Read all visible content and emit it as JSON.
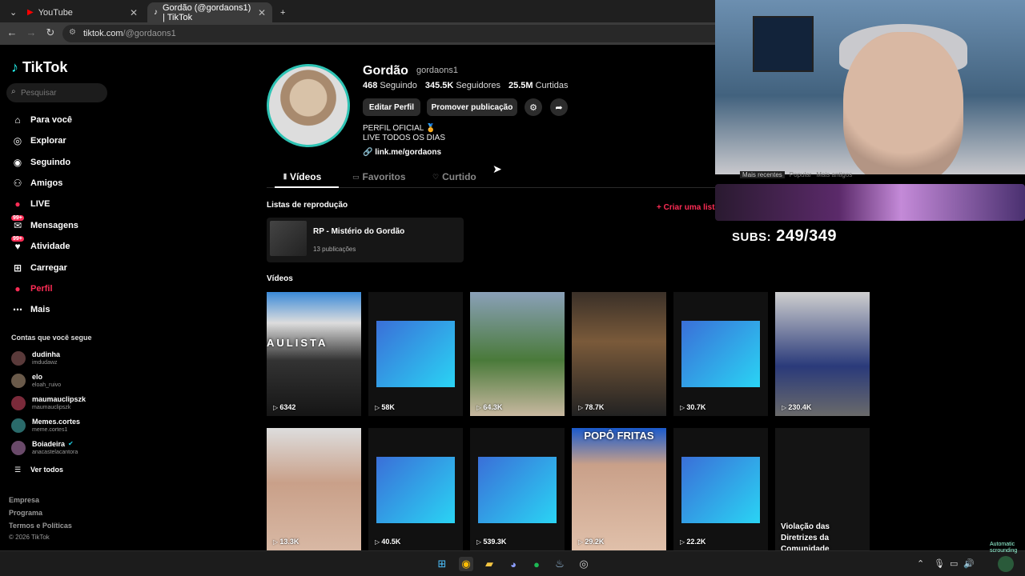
{
  "browser": {
    "tabs": [
      {
        "title": "YouTube",
        "active": false
      },
      {
        "title": "Gordão (@gordaons1) | TikTok",
        "active": true
      }
    ],
    "url_domain": "tiktok.com",
    "url_path": "/@gordaons1"
  },
  "sidebar": {
    "logo": "TikTok",
    "search_placeholder": "Pesquisar",
    "nav": [
      {
        "label": "Para você",
        "icon": "home-icon"
      },
      {
        "label": "Explorar",
        "icon": "compass-icon"
      },
      {
        "label": "Seguindo",
        "icon": "following-icon"
      },
      {
        "label": "Amigos",
        "icon": "friends-icon"
      },
      {
        "label": "LIVE",
        "icon": "live-icon"
      },
      {
        "label": "Mensagens",
        "icon": "messages-icon",
        "badge": "99+"
      },
      {
        "label": "Atividade",
        "icon": "activity-icon",
        "badge": "99+"
      },
      {
        "label": "Carregar",
        "icon": "upload-icon"
      },
      {
        "label": "Perfil",
        "icon": "profile-icon",
        "selected": true
      },
      {
        "label": "Mais",
        "icon": "more-icon"
      }
    ],
    "following_title": "Contas que você segue",
    "following": [
      {
        "name": "dudinha",
        "handle": "imdudawz"
      },
      {
        "name": "elo",
        "handle": "eloah_ruivo"
      },
      {
        "name": "maumauclipszk",
        "handle": "maumauclipszk"
      },
      {
        "name": "Memes.cortes",
        "handle": "meme.cortes1"
      },
      {
        "name": "Boiadeira",
        "handle": "anacastelacantora",
        "verified": true
      }
    ],
    "see_all": "Ver todos",
    "footer": [
      "Empresa",
      "Programa",
      "Termos e Políticas",
      "© 2026 TikTok"
    ]
  },
  "profile": {
    "name": "Gordão",
    "username": "gordaons1",
    "following_count": "468",
    "following_label": "Seguindo",
    "followers_count": "345.5K",
    "followers_label": "Seguidores",
    "likes_count": "25.5M",
    "likes_label": "Curtidas",
    "edit_button": "Editar Perfil",
    "promote_button": "Promover publicação",
    "bio_line1": "PERFIL OFICIAL 🏅",
    "bio_line2": "LIVE TODOS OS DIAS",
    "link": "link.me/gordaons"
  },
  "content_tabs": [
    "Vídeos",
    "Favoritos",
    "Curtido"
  ],
  "playlists": {
    "heading": "Listas de reprodução",
    "create_label": "+ Criar uma lista",
    "items": [
      {
        "title": "RP - Mistério do Gordão",
        "count": "13 publicações"
      }
    ]
  },
  "videos": {
    "heading": "Vídeos",
    "row1": [
      {
        "views": "6342",
        "overlay": "AULISTA"
      },
      {
        "views": "58K"
      },
      {
        "views": "64.3K"
      },
      {
        "views": "78.7K"
      },
      {
        "views": "30.7K"
      },
      {
        "views": "230.4K"
      }
    ],
    "row2": [
      {
        "views": "13.3K"
      },
      {
        "views": "40.5K"
      },
      {
        "views": "539.3K"
      },
      {
        "views": "29.2K",
        "overlay": "POPÔ FRITAS"
      },
      {
        "views": "22.2K"
      },
      {
        "views": "",
        "overlay": "Violação das Diretrizes da Comunidade"
      }
    ]
  },
  "stream_overlay": {
    "subs_label": "SUBS:",
    "subs_value": "249/349",
    "mini_tabs": [
      "Mais recentes",
      "Popular",
      "Mais antigos"
    ]
  },
  "taskbar": {
    "tray_label": "Automatic scrounding"
  },
  "colors": {
    "accent": "#fe2c55",
    "avatar_ring": "#2ec3b4",
    "background": "#000000"
  }
}
